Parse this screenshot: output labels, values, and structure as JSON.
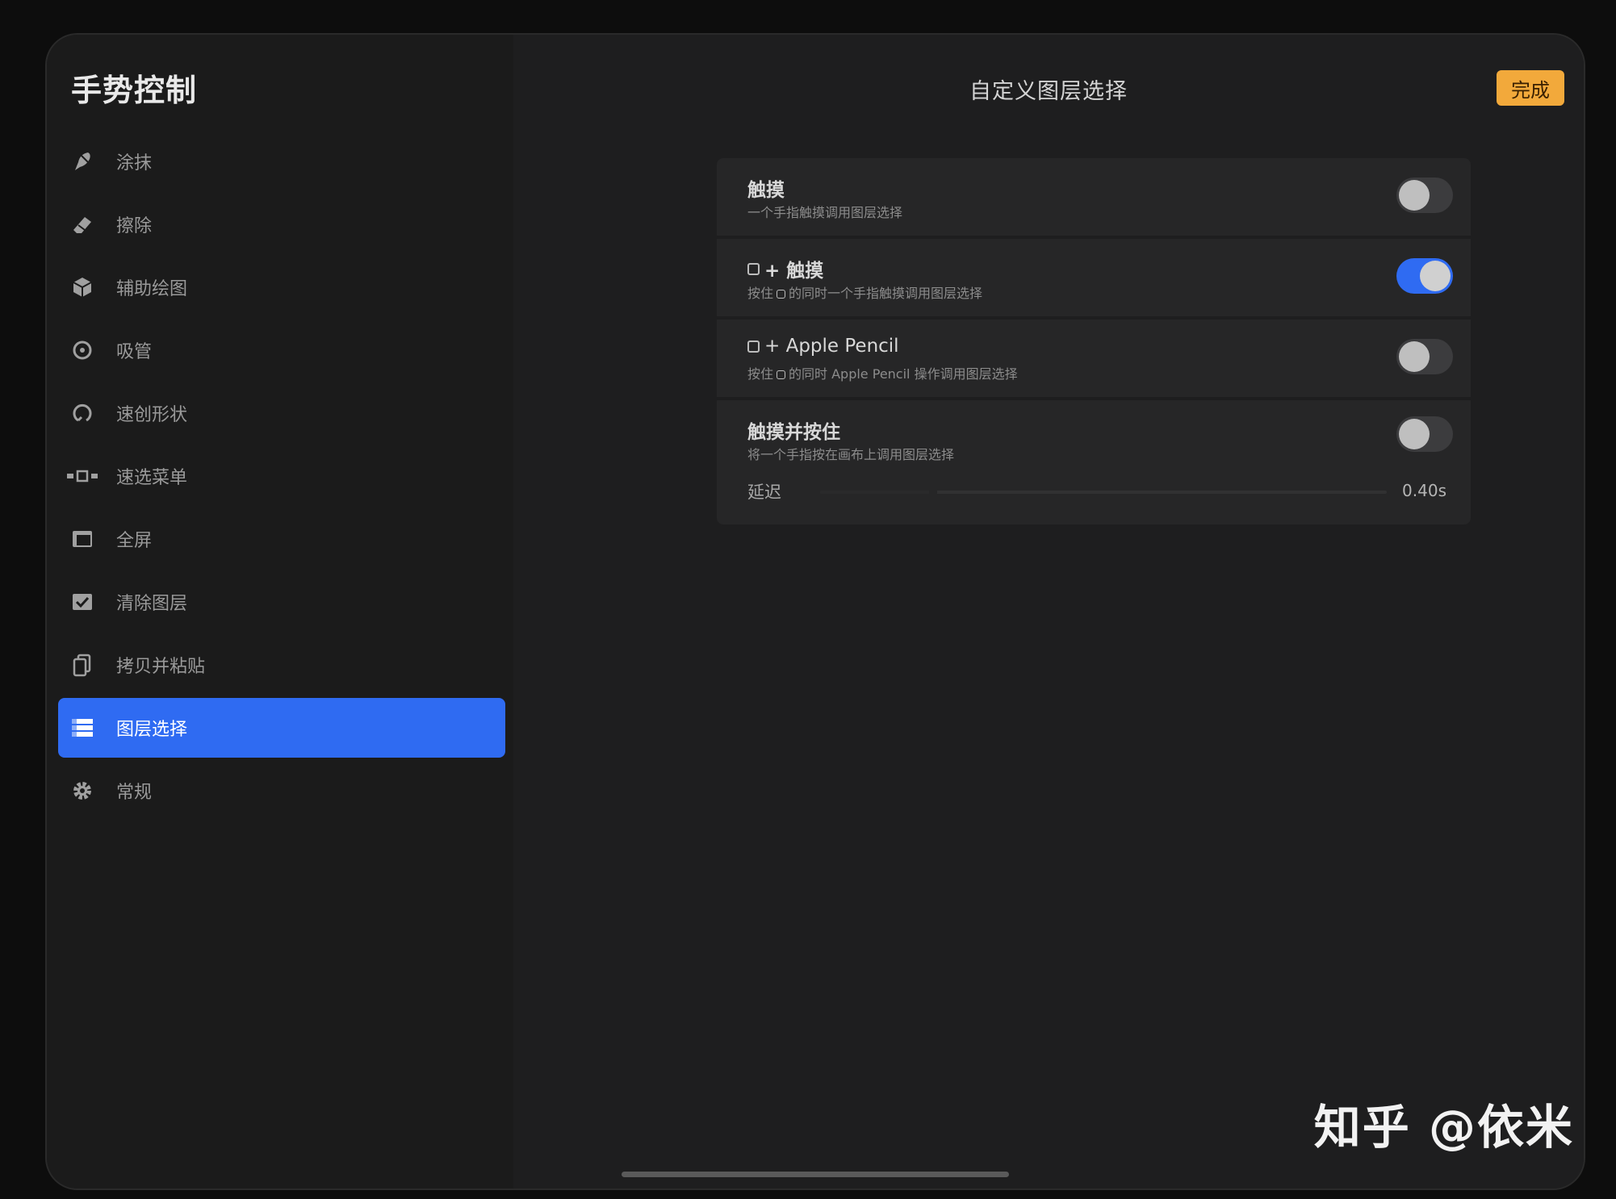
{
  "sidebar": {
    "title": "手势控制",
    "items": [
      {
        "label": "涂抹",
        "icon": "smudge-icon",
        "active": false
      },
      {
        "label": "擦除",
        "icon": "eraser-icon",
        "active": false
      },
      {
        "label": "辅助绘图",
        "icon": "drawing-guide-icon",
        "active": false
      },
      {
        "label": "吸管",
        "icon": "eyedropper-icon",
        "active": false
      },
      {
        "label": "速创形状",
        "icon": "quickshape-icon",
        "active": false
      },
      {
        "label": "速选菜单",
        "icon": "quickmenu-icon",
        "active": false
      },
      {
        "label": "全屏",
        "icon": "fullscreen-icon",
        "active": false
      },
      {
        "label": "清除图层",
        "icon": "clear-layer-icon",
        "active": false
      },
      {
        "label": "拷贝并粘贴",
        "icon": "copy-paste-icon",
        "active": false
      },
      {
        "label": "图层选择",
        "icon": "layer-select-icon",
        "active": true
      },
      {
        "label": "常规",
        "icon": "gear-icon",
        "active": false
      }
    ]
  },
  "header": {
    "title": "自定义图层选择",
    "done_label": "完成"
  },
  "settings": {
    "touch": {
      "title": "触摸",
      "subtitle": "一个手指触摸调用图层选择",
      "enabled": false
    },
    "modifier_touch": {
      "title": "+ 触摸",
      "subtitle_pre": "按住",
      "subtitle_post": "的同时一个手指触摸调用图层选择",
      "enabled": true
    },
    "modifier_pencil": {
      "title": "+ Apple Pencil",
      "subtitle_pre": "按住",
      "subtitle_post": "的同时 Apple Pencil 操作调用图层选择",
      "enabled": false
    },
    "touch_hold": {
      "title": "触摸并按住",
      "subtitle": "将一个手指按在画布上调用图层选择",
      "enabled": false
    },
    "delay": {
      "label": "延迟",
      "value": "0.40s",
      "fraction": 0.2
    }
  },
  "watermark": "知乎 @依米",
  "colors": {
    "accent": "#2f6bf2",
    "done": "#f2a93b",
    "background": "#1c1c1e"
  }
}
